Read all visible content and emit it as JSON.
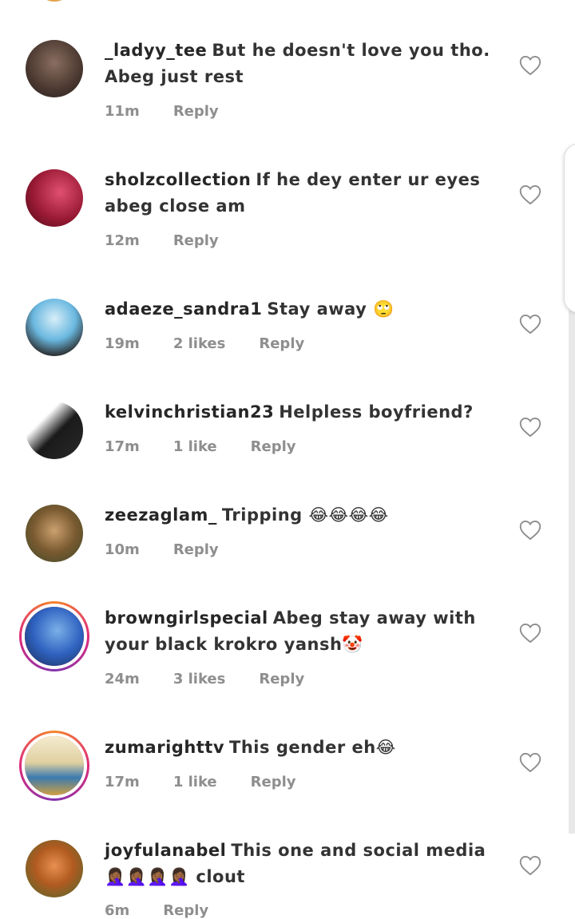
{
  "comments": [
    {
      "username": "_ladyy_tee",
      "text": "But he doesn't love you tho. Abeg just rest",
      "time": "11m",
      "likes": "",
      "reply": "Reply",
      "avatar_color": "#5a4a40"
    },
    {
      "username": "sholzcollection",
      "text": "If he dey enter ur eyes abeg close am",
      "time": "12m",
      "likes": "",
      "reply": "Reply",
      "avatar_color": "#b0203a"
    },
    {
      "username": "adaeze_sandra1",
      "text": "Stay away 🙄",
      "time": "19m",
      "likes": "2 likes",
      "reply": "Reply",
      "avatar_color": "#5aa8d8"
    },
    {
      "username": "kelvinchristian23",
      "text": "Helpless boyfriend?",
      "time": "17m",
      "likes": "1 like",
      "reply": "Reply",
      "avatar_color": "#2b2b2b"
    },
    {
      "username": "zeezaglam_",
      "text": "Tripping 😂😂😂😂",
      "time": "10m",
      "likes": "",
      "reply": "Reply",
      "avatar_color": "#8a6a3a"
    },
    {
      "username": "browngirlspecial",
      "text": "Abeg stay away with your black krokro yansh🤡",
      "time": "24m",
      "likes": "3 likes",
      "reply": "Reply",
      "avatar_color": "#3a6fc4"
    },
    {
      "username": "zumarighttv",
      "text": "This gender eh😂",
      "time": "17m",
      "likes": "1 like",
      "reply": "Reply",
      "avatar_color": "#e8d8a8"
    },
    {
      "username": "joyfulanabel",
      "text": "This one and social media 🤦🏾‍♀️🤦🏾‍♀️🤦🏾‍♀️🤦🏾‍♀️ clout",
      "time": "6m",
      "likes": "",
      "reply": "Reply",
      "avatar_color": "#d07a30"
    }
  ]
}
